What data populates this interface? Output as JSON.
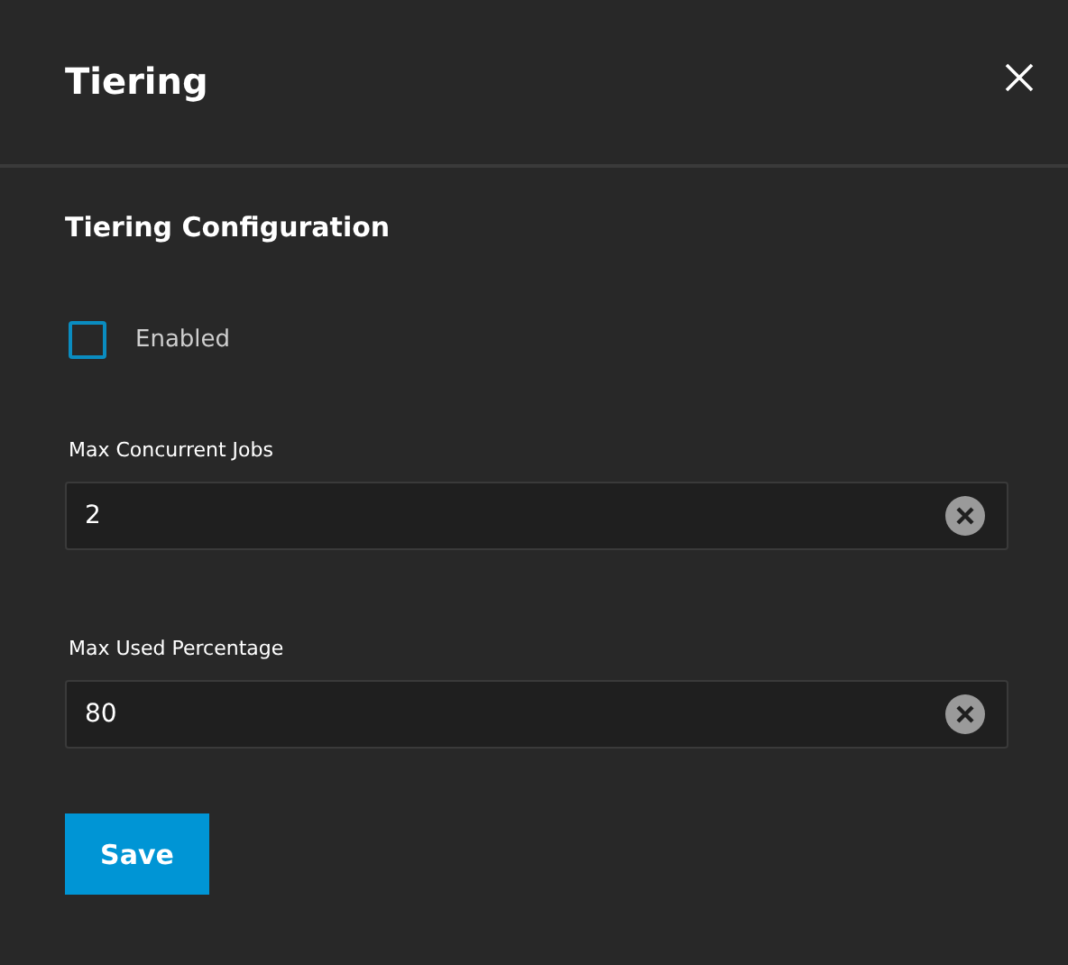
{
  "dialog": {
    "title": "Tiering"
  },
  "section_title": "Tiering Configuration",
  "enabled": {
    "label": "Enabled",
    "checked": false
  },
  "fields": [
    {
      "label": "Max Concurrent Jobs",
      "value": "2"
    },
    {
      "label": "Max Used Percentage",
      "value": "80"
    }
  ],
  "save_button": {
    "label": "Save"
  }
}
